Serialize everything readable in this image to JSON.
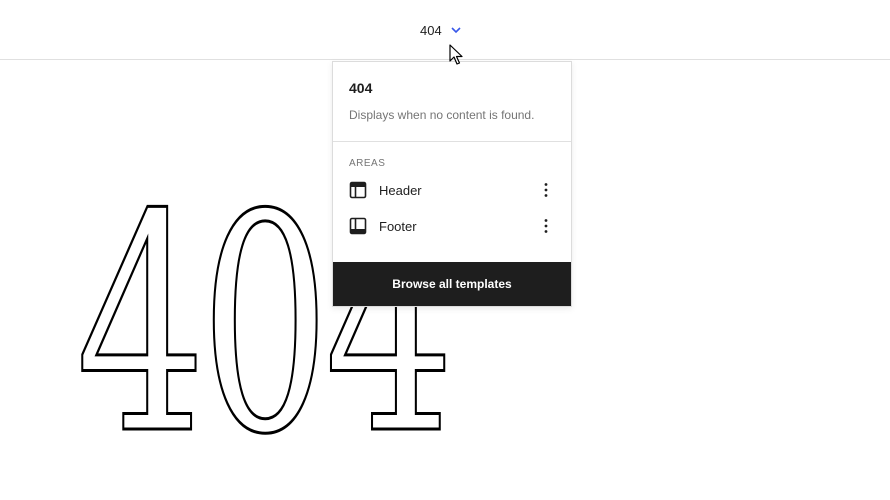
{
  "topbar": {
    "template_name": "404",
    "chevron_icon": "chevron-down-icon",
    "accent_color": "#3858e9"
  },
  "canvas": {
    "big_text": "404"
  },
  "popover": {
    "title": "404",
    "description": "Displays when no content is found.",
    "areas_label": "AREAS",
    "areas": [
      {
        "label": "Header",
        "icon": "header-layout-icon"
      },
      {
        "label": "Footer",
        "icon": "footer-layout-icon"
      }
    ],
    "browse_button": "Browse all templates"
  }
}
